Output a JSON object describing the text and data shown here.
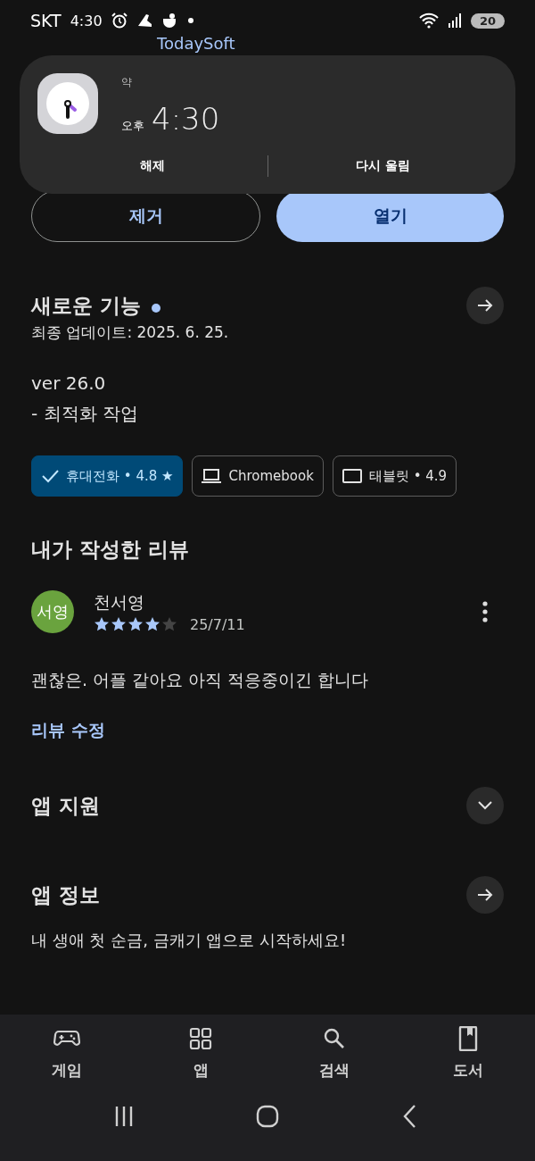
{
  "status_bar": {
    "carrier": "SKT",
    "time": "4:30",
    "battery": "20"
  },
  "behind_text": "TodaySoft",
  "notification": {
    "label": "약",
    "ampm": "오후",
    "time": "4:30",
    "actions": [
      "해제",
      "다시 울림"
    ]
  },
  "buttons": [
    {
      "label": "제거",
      "kind": "outline"
    },
    {
      "label": "열기",
      "kind": "filled"
    }
  ],
  "whats_new": {
    "title": "새로운 기능",
    "new": true,
    "subtitle": "최종 업데이트: 2025. 6. 25.",
    "lines": [
      "ver 26.0",
      "- 최적화 작업"
    ]
  },
  "device_chips": [
    {
      "label": "휴대전화 • 4.8 ★",
      "kind": "phone",
      "selected": true
    },
    {
      "label": "Chromebook",
      "kind": "laptop",
      "selected": false
    },
    {
      "label": "태블릿 • 4.9",
      "kind": "tablet",
      "selected": false
    }
  ],
  "my_review": {
    "title": "내가 작성한 리뷰",
    "avatar": "서영",
    "author": "천서영",
    "stars": 4,
    "date": "25/7/11",
    "text": "괜찮은. 어플 같아요 아직 적응중이긴 합니다",
    "edit_link": "리뷰 수정"
  },
  "sections": [
    {
      "title": "앱 지원",
      "kind": "expand",
      "expanded": false
    },
    {
      "title": "앱 정보",
      "kind": "arrow"
    }
  ],
  "app_description": "내 생애 첫 순금, 금캐기 앱으로 시작하세요!",
  "bottom_nav": [
    {
      "label": "게임",
      "kind": "games"
    },
    {
      "label": "앱",
      "kind": "apps"
    },
    {
      "label": "검색",
      "kind": "search"
    },
    {
      "label": "도서",
      "kind": "books"
    }
  ],
  "system_nav": [
    {
      "kind": "recents"
    },
    {
      "kind": "home"
    },
    {
      "kind": "back"
    }
  ]
}
